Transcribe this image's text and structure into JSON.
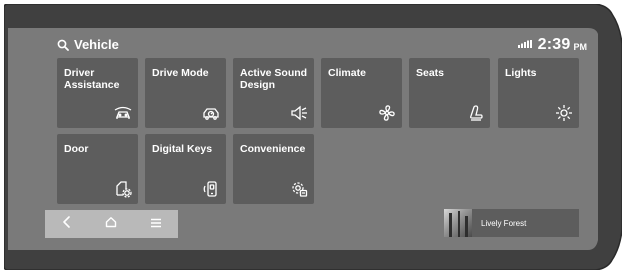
{
  "header": {
    "search_label": "Vehicle",
    "time": "2:39",
    "ampm": "PM"
  },
  "tiles": [
    {
      "label": "Driver\nAssistance",
      "icon": "driver-assistance-icon"
    },
    {
      "label": "Drive Mode",
      "icon": "drive-mode-icon"
    },
    {
      "label": "Active Sound\nDesign",
      "icon": "active-sound-icon"
    },
    {
      "label": "Climate",
      "icon": "fan-icon"
    },
    {
      "label": "Seats",
      "icon": "seat-icon"
    },
    {
      "label": "Lights",
      "icon": "light-icon"
    },
    {
      "label": "Door",
      "icon": "door-settings-icon"
    },
    {
      "label": "Digital Keys",
      "icon": "digital-key-icon"
    },
    {
      "label": "Convenience",
      "icon": "convenience-gear-icon"
    }
  ],
  "nav": {
    "back_icon": "chevron-left-icon",
    "home_icon": "home-icon",
    "menu_icon": "menu-icon"
  },
  "media": {
    "track_title": "Lively Forest"
  },
  "colors": {
    "screen": "#7a7a7a",
    "tile": "#5d5d5d",
    "nav_bar": "#b9b9b9",
    "bezel": "#404040"
  }
}
